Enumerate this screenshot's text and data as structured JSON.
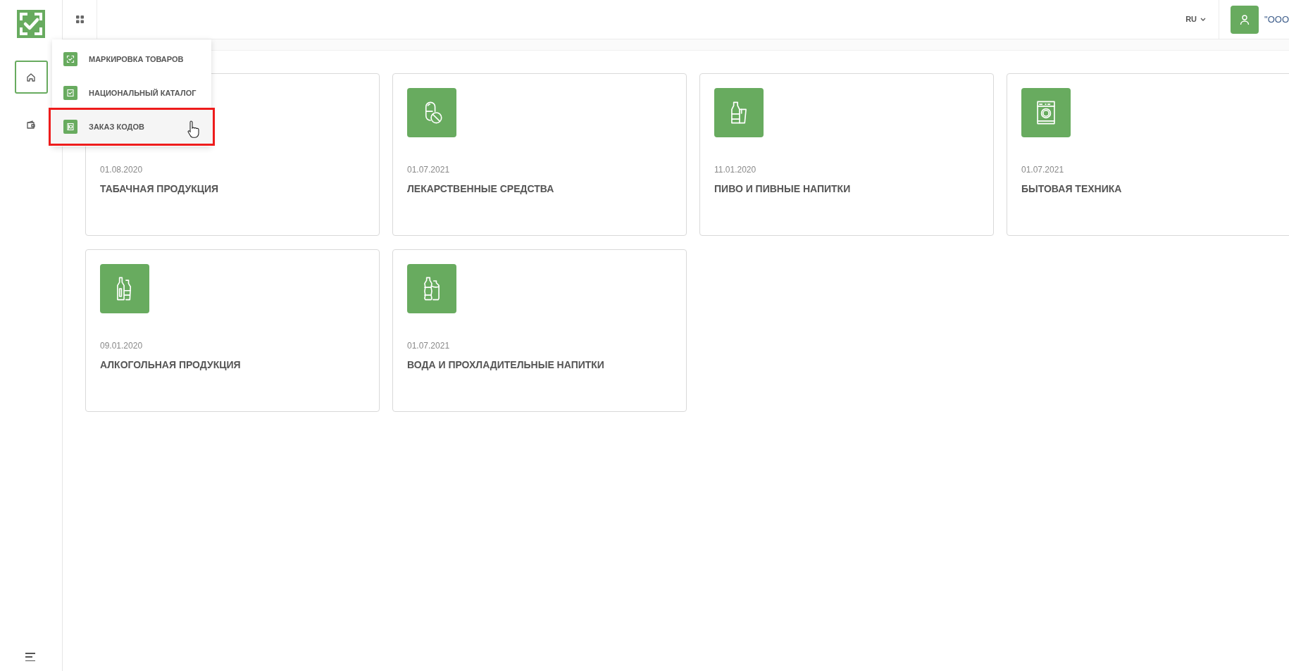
{
  "header": {
    "language": "RU",
    "user_name": "\"OOO"
  },
  "app_menu": {
    "items": [
      {
        "label": "МАРКИРОВКА ТОВАРОВ",
        "kind": "scan",
        "selected": false
      },
      {
        "label": "НАЦИОНАЛЬНЫЙ КАТАЛОГ",
        "kind": "catalog",
        "selected": false
      },
      {
        "label": "ЗАКАЗ КОДОВ",
        "kind": "order",
        "selected": true
      }
    ]
  },
  "sidebar": {
    "items": [
      {
        "kind": "home",
        "selected": true
      },
      {
        "kind": "wallet",
        "selected": false
      }
    ]
  },
  "cards": [
    {
      "date": "01.08.2020",
      "title": "ТАБАЧНАЯ ПРОДУКЦИЯ",
      "kind": "covered"
    },
    {
      "date": "01.07.2021",
      "title": "ЛЕКАРСТВЕННЫЕ СРЕДСТВА",
      "kind": "pill"
    },
    {
      "date": "11.01.2020",
      "title": "ПИВО И ПИВНЫЕ НАПИТКИ",
      "kind": "beer"
    },
    {
      "date": "01.07.2021",
      "title": "БЫТОВАЯ ТЕХНИКА",
      "kind": "washer"
    },
    {
      "date": "09.01.2020",
      "title": "АЛКОГОЛЬНАЯ ПРОДУКЦИЯ",
      "kind": "bottles"
    },
    {
      "date": "01.07.2021",
      "title": "ВОДА И ПРОХЛАДИТЕЛЬНЫЕ НАПИТКИ",
      "kind": "water"
    }
  ]
}
